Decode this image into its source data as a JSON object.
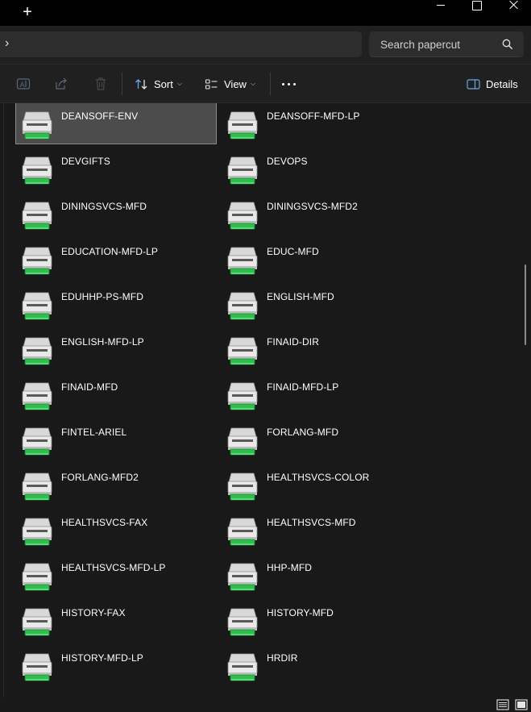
{
  "titlebar": {
    "new_tab_glyph": "+",
    "minimize_icon": "minimize-icon",
    "maximize_icon": "maximize-icon",
    "close_icon": "close-icon"
  },
  "address": {
    "chevron": "›"
  },
  "search": {
    "placeholder": "Search papercut",
    "icon": "search-icon"
  },
  "toolbar": {
    "rename_icon": "rename-icon",
    "share_icon": "share-icon",
    "delete_icon": "delete-icon",
    "sort_label": "Sort",
    "view_label": "View",
    "more_icon": "more-icon",
    "details_label": "Details"
  },
  "items": [
    {
      "name": "DEANSOFF-ENV",
      "selected": true
    },
    {
      "name": "DEANSOFF-MFD-LP"
    },
    {
      "name": "DEVGIFTS"
    },
    {
      "name": "DEVOPS"
    },
    {
      "name": "DININGSVCS-MFD"
    },
    {
      "name": "DININGSVCS-MFD2"
    },
    {
      "name": "EDUCATION-MFD-LP"
    },
    {
      "name": "EDUC-MFD"
    },
    {
      "name": "EDUHHP-PS-MFD"
    },
    {
      "name": "ENGLISH-MFD"
    },
    {
      "name": "ENGLISH-MFD-LP"
    },
    {
      "name": "FINAID-DIR"
    },
    {
      "name": "FINAID-MFD"
    },
    {
      "name": "FINAID-MFD-LP"
    },
    {
      "name": "FINTEL-ARIEL"
    },
    {
      "name": "FORLANG-MFD"
    },
    {
      "name": "FORLANG-MFD2"
    },
    {
      "name": "HEALTHSVCS-COLOR"
    },
    {
      "name": "HEALTHSVCS-FAX"
    },
    {
      "name": "HEALTHSVCS-MFD"
    },
    {
      "name": "HEALTHSVCS-MFD-LP"
    },
    {
      "name": "HHP-MFD"
    },
    {
      "name": "HISTORY-FAX"
    },
    {
      "name": "HISTORY-MFD"
    },
    {
      "name": "HISTORY-MFD-LP"
    },
    {
      "name": "HRDIR"
    }
  ],
  "statusbar": {
    "details_view_icon": "details-view-icon",
    "tiles_view_icon": "large-icons-view-icon"
  },
  "colors": {
    "background": "#191919",
    "toolbar": "#202020",
    "selected": "#4c4c4c",
    "printer_green": "#2fbf4f"
  }
}
